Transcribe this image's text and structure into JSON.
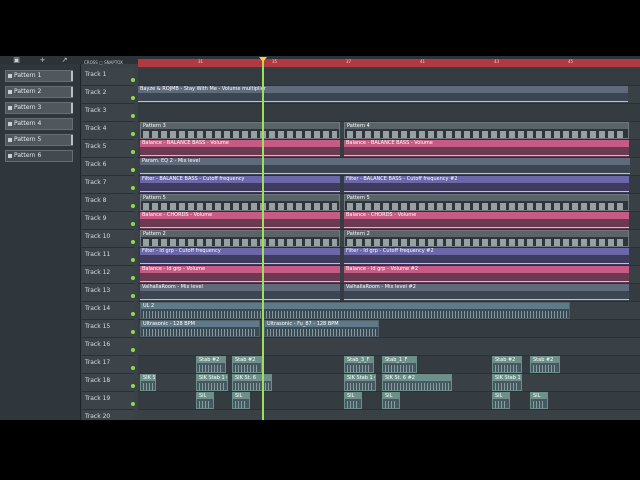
{
  "toolbar": {
    "cross_label": "CROSS",
    "snap_label": "SNAPTOX"
  },
  "ruler": {
    "bars": [
      "31",
      "35",
      "37",
      "41",
      "43",
      "45"
    ]
  },
  "patterns": [
    "Pattern 1",
    "Pattern 2",
    "Pattern 3",
    "Pattern 4",
    "Pattern 5",
    "Pattern 6"
  ],
  "tracks": [
    {
      "name": "Track 1",
      "clips": []
    },
    {
      "name": "Track 2",
      "clips": [
        {
          "kind": "auto-slate",
          "label": "Bayze & ROJMB - Stay With Me - Volume multiplier"
        }
      ]
    },
    {
      "name": "Track 3",
      "clips": []
    },
    {
      "name": "Track 4",
      "clips": [
        {
          "kind": "pattern",
          "label": "Pattern 3"
        },
        {
          "kind": "pattern",
          "label": "Pattern 4"
        }
      ]
    },
    {
      "name": "Track 5",
      "clips": [
        {
          "kind": "auto-pink",
          "label": "Balance - BALANCE BASS - Volume"
        },
        {
          "kind": "auto-pink",
          "label": "Balance - BALANCE BASS - Volume"
        }
      ]
    },
    {
      "name": "Track 6",
      "clips": [
        {
          "kind": "auto-slate",
          "label": "Param. EQ 2 - Mix level"
        }
      ]
    },
    {
      "name": "Track 7",
      "clips": [
        {
          "kind": "auto-purple",
          "label": "Filter - BALANCE BASS - Cutoff frequency"
        },
        {
          "kind": "auto-purple",
          "label": "Filter - BALANCE BASS - Cutoff frequency #2"
        }
      ]
    },
    {
      "name": "Track 8",
      "clips": [
        {
          "kind": "pattern",
          "label": "Pattern 5"
        },
        {
          "kind": "pattern",
          "label": "Pattern 5"
        }
      ]
    },
    {
      "name": "Track 9",
      "clips": [
        {
          "kind": "auto-pink",
          "label": "Balance - CHORDS - Volume"
        },
        {
          "kind": "auto-pink",
          "label": "Balance - CHORDS - Volume"
        }
      ]
    },
    {
      "name": "Track 10",
      "clips": [
        {
          "kind": "pattern",
          "label": "Pattern 2"
        },
        {
          "kind": "pattern",
          "label": "Pattern 2"
        }
      ]
    },
    {
      "name": "Track 11",
      "clips": [
        {
          "kind": "auto-purple",
          "label": "Filter - ld grp - Cutoff frequency"
        },
        {
          "kind": "auto-purple",
          "label": "Filter - ld grp - Cutoff frequency #2"
        }
      ]
    },
    {
      "name": "Track 12",
      "clips": [
        {
          "kind": "auto-pink",
          "label": "Balance - ld grp - Volume"
        },
        {
          "kind": "auto-pink",
          "label": "Balance - ld grp - Volume #2"
        }
      ]
    },
    {
      "name": "Track 13",
      "clips": [
        {
          "kind": "auto-slate",
          "label": "ValhallaRoom - Mix level"
        },
        {
          "kind": "auto-slate",
          "label": "ValhallaRoom - Mix level #2"
        }
      ]
    },
    {
      "name": "Track 14",
      "clips": [
        {
          "kind": "audio",
          "label": "UL 2"
        }
      ]
    },
    {
      "name": "Track 15",
      "clips": [
        {
          "kind": "audio",
          "label": "Ultrasonic - 128 BPM"
        },
        {
          "kind": "audio",
          "label": "Ultrasonic - Fu_87 - 128 BPM"
        }
      ]
    },
    {
      "name": "Track 16",
      "clips": []
    },
    {
      "name": "Track 17",
      "clips": [
        {
          "kind": "sample",
          "label": "Stab #2"
        },
        {
          "kind": "sample",
          "label": "Stab #2"
        },
        {
          "kind": "sample",
          "label": "Stab_3_F"
        },
        {
          "kind": "sample",
          "label": "Stab_1_F"
        },
        {
          "kind": "sample",
          "label": "Stab #2"
        },
        {
          "kind": "sample",
          "label": "Stab #2"
        }
      ]
    },
    {
      "name": "Track 18",
      "clips": [
        {
          "kind": "sample",
          "label": "SIK St. 6 #2"
        },
        {
          "kind": "sample",
          "label": "SIK Stab 1 6 #2"
        },
        {
          "kind": "sample",
          "label": "SIK St. 6"
        },
        {
          "kind": "sample",
          "label": "SIK Stab 1 6"
        },
        {
          "kind": "sample",
          "label": "SIK St. 6 #2"
        },
        {
          "kind": "sample",
          "label": "SIK Stab 1 6 #2"
        }
      ]
    },
    {
      "name": "Track 19",
      "clips": [
        {
          "kind": "sample",
          "label": "SIL"
        },
        {
          "kind": "sample",
          "label": "SIL"
        },
        {
          "kind": "sample",
          "label": "SIL"
        },
        {
          "kind": "sample",
          "label": "SIL"
        },
        {
          "kind": "sample",
          "label": "SIL"
        },
        {
          "kind": "sample",
          "label": "SIL"
        }
      ]
    },
    {
      "name": "Track 20",
      "clips": []
    }
  ]
}
